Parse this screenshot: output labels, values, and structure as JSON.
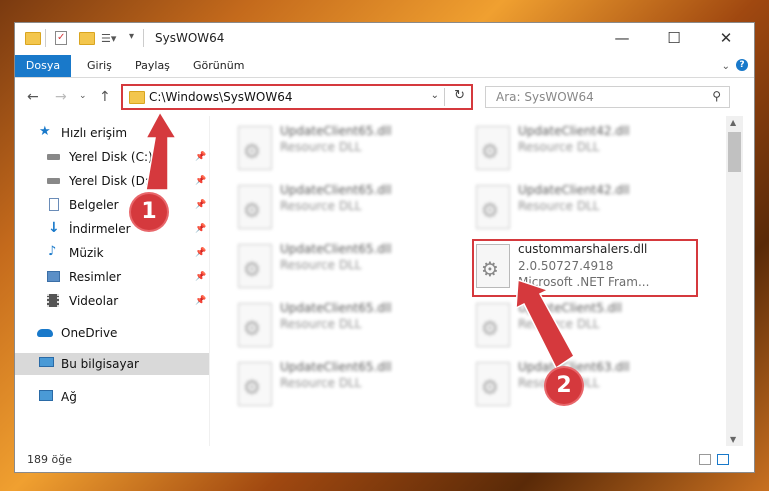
{
  "window": {
    "title": "SysWOW64",
    "minimize": "—",
    "maximize": "☐",
    "close": "✕"
  },
  "ribbon": {
    "tabs": [
      "Dosya",
      "Giriş",
      "Paylaş",
      "Görünüm"
    ]
  },
  "address": {
    "path": "C:\\Windows\\SysWOW64"
  },
  "search": {
    "placeholder": "Ara: SysWOW64"
  },
  "sidebar": {
    "items": [
      {
        "label": "Hızlı erişim",
        "icon": "star-icon"
      },
      {
        "label": "Yerel Disk (C:)",
        "icon": "drive-icon",
        "pinned": true
      },
      {
        "label": "Yerel Disk (D:)",
        "icon": "drive-icon",
        "pinned": true
      },
      {
        "label": "Belgeler",
        "icon": "documents-icon",
        "pinned": true
      },
      {
        "label": "İndirmeler",
        "icon": "download-icon",
        "pinned": true
      },
      {
        "label": "Müzik",
        "icon": "music-icon",
        "pinned": true
      },
      {
        "label": "Resimler",
        "icon": "pictures-icon",
        "pinned": true
      },
      {
        "label": "Videolar",
        "icon": "videos-icon",
        "pinned": true
      },
      {
        "label": "OneDrive",
        "icon": "cloud-icon"
      },
      {
        "label": "Bu bilgisayar",
        "icon": "computer-icon",
        "selected": true
      },
      {
        "label": "Ağ",
        "icon": "network-icon"
      }
    ]
  },
  "files": [
    {
      "name": "UpdateClient65.dll",
      "line1": "Resource DLL",
      "blurred": true
    },
    {
      "name": "UpdateClient42.dll",
      "line1": "Resource DLL",
      "blurred": true
    },
    {
      "name": "UpdateClient65.dll",
      "line1": "Resource DLL",
      "blurred": true
    },
    {
      "name": "UpdateClient42.dll",
      "line1": "Resource DLL",
      "blurred": true
    },
    {
      "name": "UpdateClient65.dll",
      "line1": "Resource DLL",
      "blurred": true
    },
    {
      "name": "custommarshalers.dll",
      "line1": "2.0.50727.4918",
      "line2": "Microsoft .NET Fram...",
      "blurred": false
    },
    {
      "name": "UpdateClient65.dll",
      "line1": "Resource DLL",
      "blurred": true
    },
    {
      "name": "UpdateClient5.dll",
      "line1": "Resource DLL",
      "blurred": true
    },
    {
      "name": "UpdateClient65.dll",
      "line1": "Resource DLL",
      "blurred": true
    },
    {
      "name": "UpdateClient63.dll",
      "line1": "Resource DLL",
      "blurred": true
    }
  ],
  "status": {
    "count": "189 öğe"
  },
  "callouts": [
    "1",
    "2"
  ],
  "colors": {
    "accent": "#1979ca",
    "highlight": "#d5393d"
  }
}
